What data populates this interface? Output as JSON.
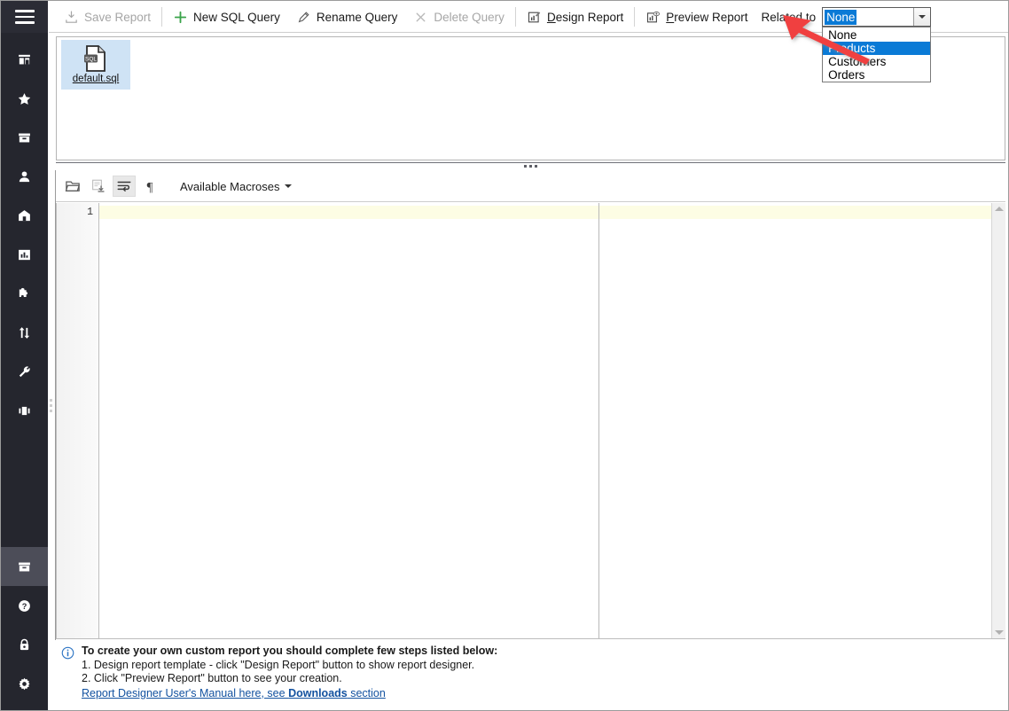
{
  "sidebar": {
    "menu_icon": "hamburger-icon",
    "items": [
      {
        "icon": "store-icon",
        "name": "store"
      },
      {
        "icon": "star-icon",
        "name": "favorites"
      },
      {
        "icon": "archive-box-icon",
        "name": "catalog"
      },
      {
        "icon": "user-icon",
        "name": "customers"
      },
      {
        "icon": "gift-icon",
        "name": "promotions"
      },
      {
        "icon": "bar-chart-icon",
        "name": "reports"
      },
      {
        "icon": "puzzle-icon",
        "name": "extensions"
      },
      {
        "icon": "import-export-icon",
        "name": "import-export"
      },
      {
        "icon": "wrench-icon",
        "name": "tools"
      },
      {
        "icon": "panel-icon",
        "name": "layout"
      }
    ],
    "bottom_items": [
      {
        "icon": "archive-box-icon",
        "name": "reports-active",
        "active": true
      },
      {
        "icon": "help-icon",
        "name": "help",
        "active": false
      },
      {
        "icon": "lock-icon",
        "name": "security",
        "active": false
      },
      {
        "icon": "gear-icon",
        "name": "settings",
        "active": false
      }
    ]
  },
  "toolbar": {
    "save_report": "Save Report",
    "new_sql_query": "New SQL Query",
    "rename_query": "Rename Query",
    "delete_query": "Delete Query",
    "design_report_accel": "D",
    "design_report_rest": "esign Report",
    "preview_report_accel": "P",
    "preview_report_rest": "review Report",
    "related_to_label": "Related to"
  },
  "combo": {
    "value": "None",
    "options": [
      "None",
      "Products",
      "Customers",
      "Orders"
    ],
    "highlighted": "Products",
    "selected_bg": "#0a7ad6",
    "expanded": true
  },
  "file_panel": {
    "file_name": "default.sql",
    "file_icon": "sql-file-icon",
    "selected_bg": "#cfe3f5"
  },
  "editor_toolbar": {
    "buttons": [
      {
        "icon": "open-folder-icon",
        "name": "open-file",
        "active": false
      },
      {
        "icon": "save-file-icon",
        "name": "save-file",
        "active": false
      },
      {
        "icon": "word-wrap-icon",
        "name": "word-wrap",
        "active": true
      },
      {
        "icon": "pilcrow-icon",
        "name": "show-invisibles",
        "active": false
      }
    ],
    "macros_label": "Available Macroses"
  },
  "editor": {
    "line_numbers": [
      "1"
    ],
    "content": "",
    "current_line_color": "#fdfde4"
  },
  "info": {
    "icon": "info-icon",
    "title": "To create your own custom report you should complete few steps listed below:",
    "step1": "1. Design report template - click \"Design Report\" button to show report designer.",
    "step2": "2. Click \"Preview Report\" button to see your creation.",
    "link_prefix": "Report Designer User's Manual here, see ",
    "link_bold": "Downloads",
    "link_suffix": " section"
  },
  "annotation": {
    "arrow_color": "#f04040",
    "name": "red-pointer-arrow"
  }
}
